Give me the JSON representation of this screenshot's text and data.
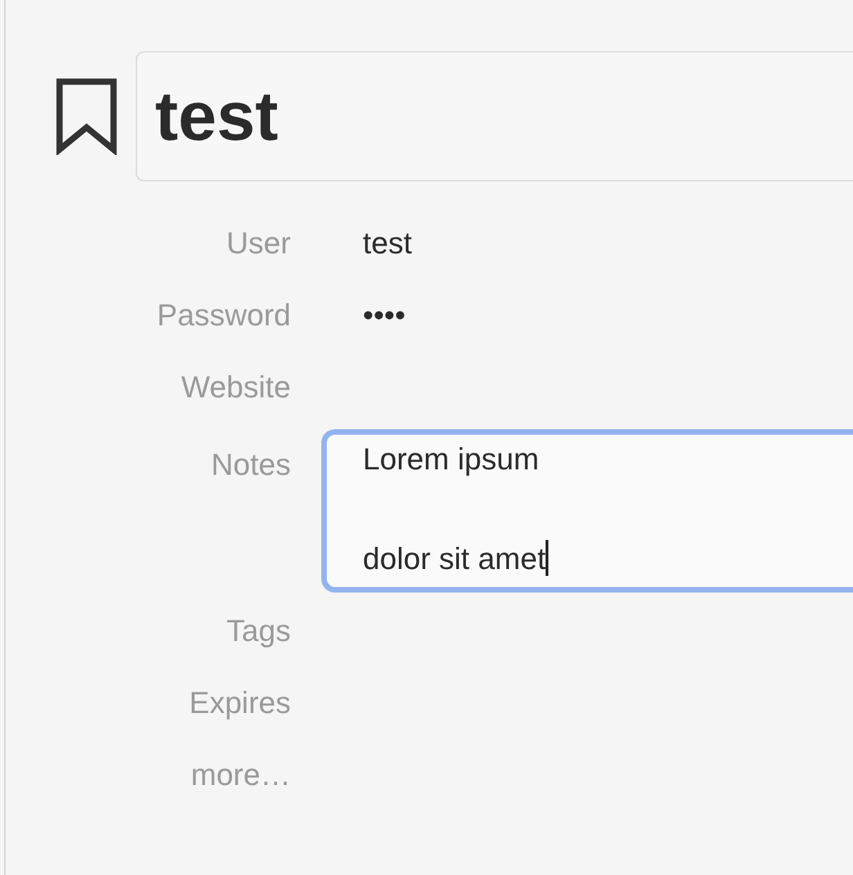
{
  "title": {
    "value": "test"
  },
  "fields": [
    {
      "kind": "text",
      "label": "User",
      "value": "test"
    },
    {
      "kind": "text",
      "label": "Password",
      "value": "••••"
    },
    {
      "kind": "text",
      "label": "Website"
    },
    {
      "kind": "notes",
      "label": "Notes",
      "value": "Lorem ipsum\n\ndolor sit amet",
      "focused": true
    },
    {
      "kind": "text",
      "label": "Tags"
    },
    {
      "kind": "text",
      "label": "Expires"
    },
    {
      "kind": "link",
      "label": "more…"
    }
  ]
}
